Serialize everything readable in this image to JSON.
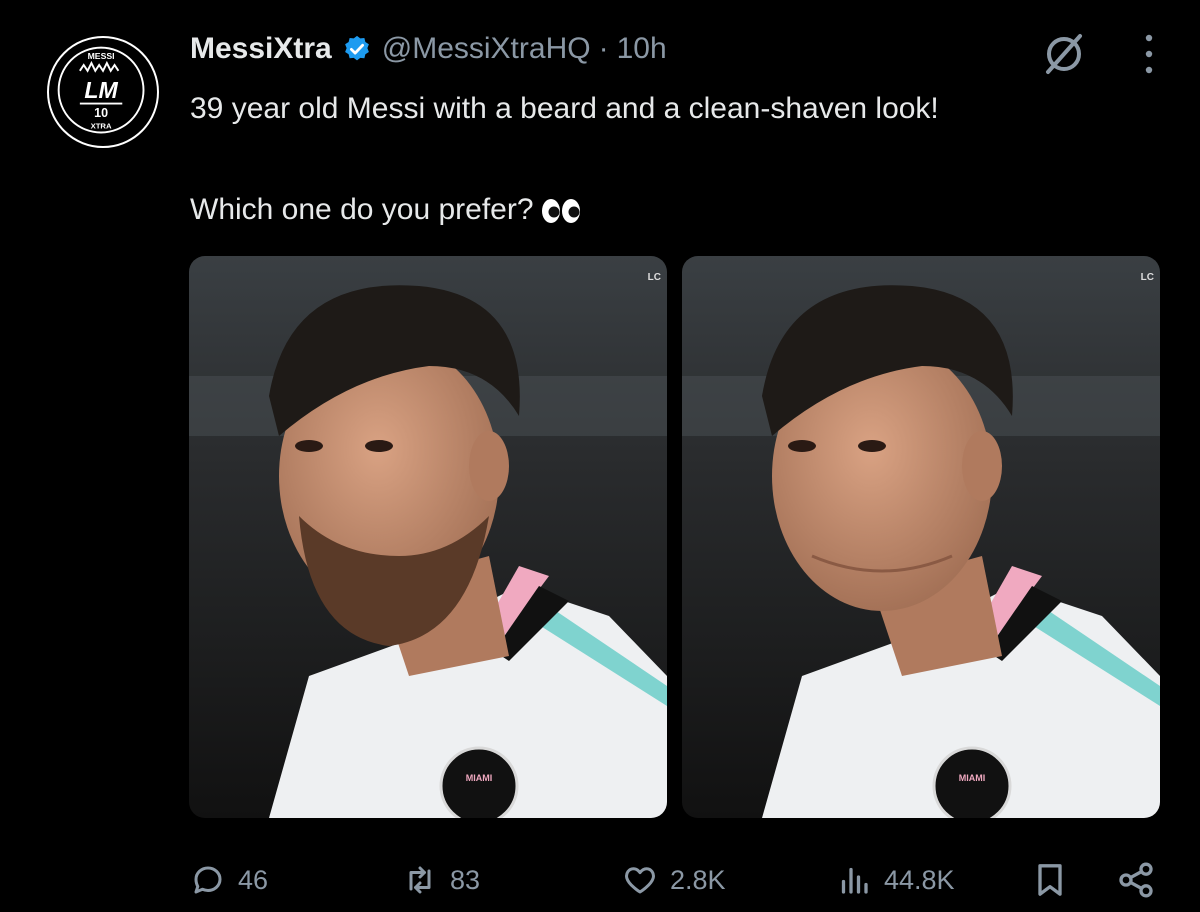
{
  "tweet": {
    "author_name": "MessiXtra",
    "author_handle": "@MessiXtraHQ",
    "separator": "·",
    "time": "10h",
    "text_line1": "39 year old Messi with a beard and a clean-shaven look!",
    "text_line2": "Which one do you prefer?",
    "emoji": "👀"
  },
  "avatar": {
    "logo_text": "LM",
    "number": "10",
    "ring_top": "MESSI",
    "ring_bottom": "XTRA"
  },
  "media": [
    {
      "description": "bearded"
    },
    {
      "description": "clean-shaven"
    }
  ],
  "watermark": "LC",
  "crest_text": "MIAMI",
  "actions": {
    "replies": "46",
    "reposts": "83",
    "likes": "2.8K",
    "views": "44.8K"
  },
  "icons": {
    "verified": "verified-badge-icon",
    "grok": "grok-icon",
    "more": "more-vertical-icon",
    "reply": "reply-icon",
    "repost": "repost-icon",
    "like": "heart-icon",
    "views": "views-icon",
    "bookmark": "bookmark-icon",
    "share": "share-icon"
  },
  "colors": {
    "background": "#000000",
    "text": "#e7e9ea",
    "muted": "#8b98a5",
    "verified": "#1d9bf0"
  }
}
